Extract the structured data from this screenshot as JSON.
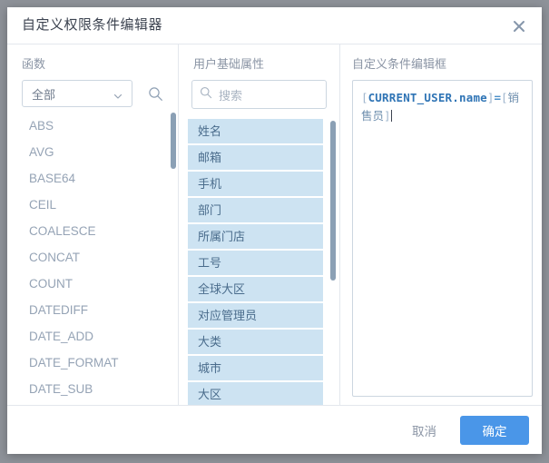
{
  "dialog": {
    "title": "自定义权限条件编辑器",
    "close_icon": "close-icon"
  },
  "functions_panel": {
    "label": "函数",
    "category_select": {
      "value": "全部",
      "chevron_icon": "chevron-down-icon"
    },
    "search_icon": "search-icon",
    "items": [
      "ABS",
      "AVG",
      "BASE64",
      "CEIL",
      "COALESCE",
      "CONCAT",
      "COUNT",
      "DATEDIFF",
      "DATE_ADD",
      "DATE_FORMAT",
      "DATE_SUB"
    ]
  },
  "attributes_panel": {
    "label": "用户基础属性",
    "search": {
      "value": "",
      "placeholder": "搜索",
      "icon": "search-icon"
    },
    "items": [
      "姓名",
      "邮箱",
      "手机",
      "部门",
      "所属门店",
      "工号",
      "全球大区",
      "对应管理员",
      "大类",
      "城市",
      "大区"
    ]
  },
  "editor_panel": {
    "label": "自定义条件编辑框",
    "expression": {
      "full_text": "[CURRENT_USER.name]=[销售员]",
      "open_bracket_1": "[",
      "variable": "CURRENT_USER.name",
      "close_bracket_1": "]",
      "operator": "=",
      "open_bracket_2": "[",
      "value": "销售员",
      "close_bracket_2": "]"
    }
  },
  "footer": {
    "cancel_label": "取消",
    "confirm_label": "确定"
  },
  "colors": {
    "primary": "#4a96e8",
    "attribute_item_bg": "#cde3f2",
    "attribute_item_text": "#4a6c8c",
    "muted_text": "#8b95a5",
    "border": "#ccd6e0",
    "backdrop": "#8e9299"
  }
}
